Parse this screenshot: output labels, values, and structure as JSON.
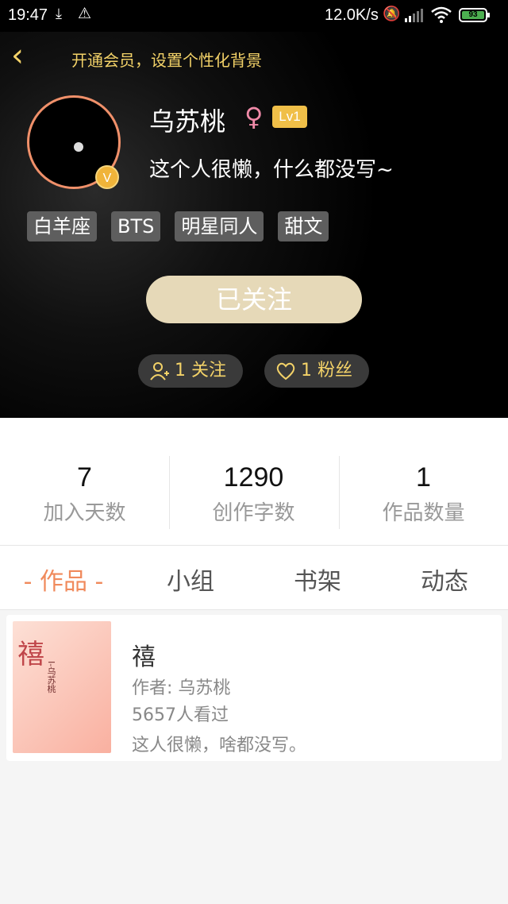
{
  "status_bar": {
    "time": "19:47",
    "speed": "12.0K/s",
    "battery": "93"
  },
  "header": {
    "vip_link": "开通会员，设置个性化背景",
    "username": "乌苏桃",
    "level": "Lv1",
    "vip_badge": "V",
    "bio": "这个人很懒，什么都没写~",
    "tags": [
      "白羊座",
      "BTS",
      "明星同人",
      "甜文"
    ],
    "follow_button": "已关注",
    "following": "1 关注",
    "fans": "1 粉丝"
  },
  "stats": [
    {
      "value": "7",
      "label": "加入天数"
    },
    {
      "value": "1290",
      "label": "创作字数"
    },
    {
      "value": "1",
      "label": "作品数量"
    }
  ],
  "tabs": [
    {
      "label": "- 作品 -",
      "active": true
    },
    {
      "label": "小组",
      "active": false
    },
    {
      "label": "书架",
      "active": false
    },
    {
      "label": "动态",
      "active": false
    }
  ],
  "work": {
    "cover_title": "禧",
    "cover_subtitle": "I-乌苏桃",
    "title": "禧",
    "author": "作者: 乌苏桃",
    "views": "5657人看过",
    "description": "这人很懒，啥都没写。"
  },
  "colors": {
    "accent": "#f08a5c",
    "gold": "#f3d268",
    "follow_bg": "#e6d9b8"
  }
}
